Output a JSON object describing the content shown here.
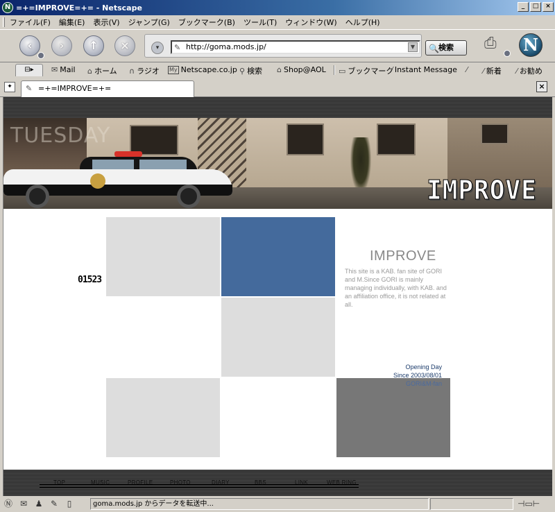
{
  "window": {
    "title": "=+=IMPROVE=+= - Netscape",
    "app_icon": "netscape-n-icon",
    "buttons": [
      "_",
      "□",
      "×"
    ]
  },
  "menu": {
    "items": [
      "ファイル(F)",
      "編集(E)",
      "表示(V)",
      "ジャンプ(G)",
      "ブックマーク(B)",
      "ツール(T)",
      "ウィンドウ(W)",
      "ヘルプ(H)"
    ]
  },
  "navbar": {
    "url": "http://goma.mods.jp/",
    "search_label": "検索",
    "back_icon": "back-arrow-icon",
    "forward_icon": "forward-arrow-icon",
    "reload_icon": "reload-icon",
    "stop_icon": "stop-icon"
  },
  "personal_toolbar": {
    "items": [
      {
        "label": "Mail",
        "icon": "mail-icon"
      },
      {
        "label": "ホーム",
        "icon": "home-icon"
      },
      {
        "label": "ラジオ",
        "icon": "radio-icon"
      },
      {
        "label": "Netscape.co.jp",
        "icon": "my-netscape-icon"
      },
      {
        "label": "検索",
        "icon": "search-icon"
      },
      {
        "label": "Shop@AOL",
        "icon": "shop-icon"
      },
      {
        "label": "ブックマーク",
        "icon": "bookmark-icon"
      },
      {
        "label": "Instant Message",
        "icon": "link-icon"
      },
      {
        "label": "新着",
        "icon": "link-icon"
      },
      {
        "label": "お勧め",
        "icon": "link-icon"
      }
    ]
  },
  "tab": {
    "title": "=+=IMPROVE=+="
  },
  "page": {
    "banner_day": "TUESDAY",
    "banner_logo": "IMPROVE",
    "counter": "01523",
    "site_title": "IMPROVE",
    "description": "This site is a KAB. fan site of GORI and M.Since GORI is mainly managing individually, with KAB. and an affiliation office, it is not related at all.",
    "opening_label": "Opening Day",
    "opening_date": "Since 2003/08/01",
    "author": "GORI&M-fan",
    "colors": {
      "tile_light": "#dddddd",
      "tile_blue": "#446a9c",
      "tile_dark": "#777777"
    },
    "footer_nav": [
      "TOP",
      "MUSIC",
      "PROFILE",
      "PHOTO",
      "DIARY",
      "BBS",
      "LINK",
      "WEB RING"
    ]
  },
  "status": {
    "text": "goma.mods.jp からデータを転送中..."
  }
}
